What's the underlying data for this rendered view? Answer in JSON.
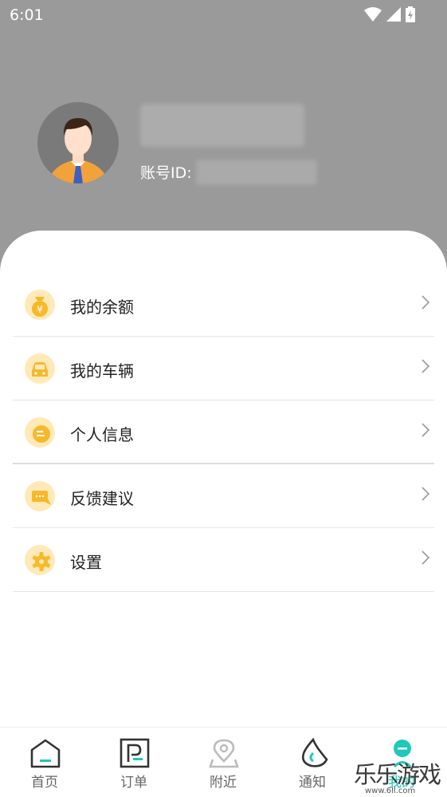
{
  "status": {
    "time": "6:01"
  },
  "profile": {
    "account_label": "账号ID:"
  },
  "menu": [
    {
      "label": "我的余额",
      "icon": "money-bag-icon"
    },
    {
      "label": "我的车辆",
      "icon": "car-icon"
    },
    {
      "label": "个人信息",
      "icon": "profile-card-icon"
    },
    {
      "label": "反馈建议",
      "icon": "chat-bubble-icon"
    },
    {
      "label": "设置",
      "icon": "gear-icon"
    }
  ],
  "tabs": [
    {
      "label": "首页",
      "icon": "home-icon"
    },
    {
      "label": "订单",
      "icon": "parking-ticket-icon"
    },
    {
      "label": "附近",
      "icon": "location-pin-icon"
    },
    {
      "label": "通知",
      "icon": "notification-icon"
    },
    {
      "label": "我的",
      "icon": "profile-active-icon"
    }
  ],
  "watermark": {
    "text": "乐乐游戏",
    "url": "www.6ll.com"
  },
  "colors": {
    "header": "#9a9a9a",
    "icon_bg": "#ffe9b8",
    "icon_fg": "#f6b92b",
    "accent": "#1fc8b9"
  }
}
